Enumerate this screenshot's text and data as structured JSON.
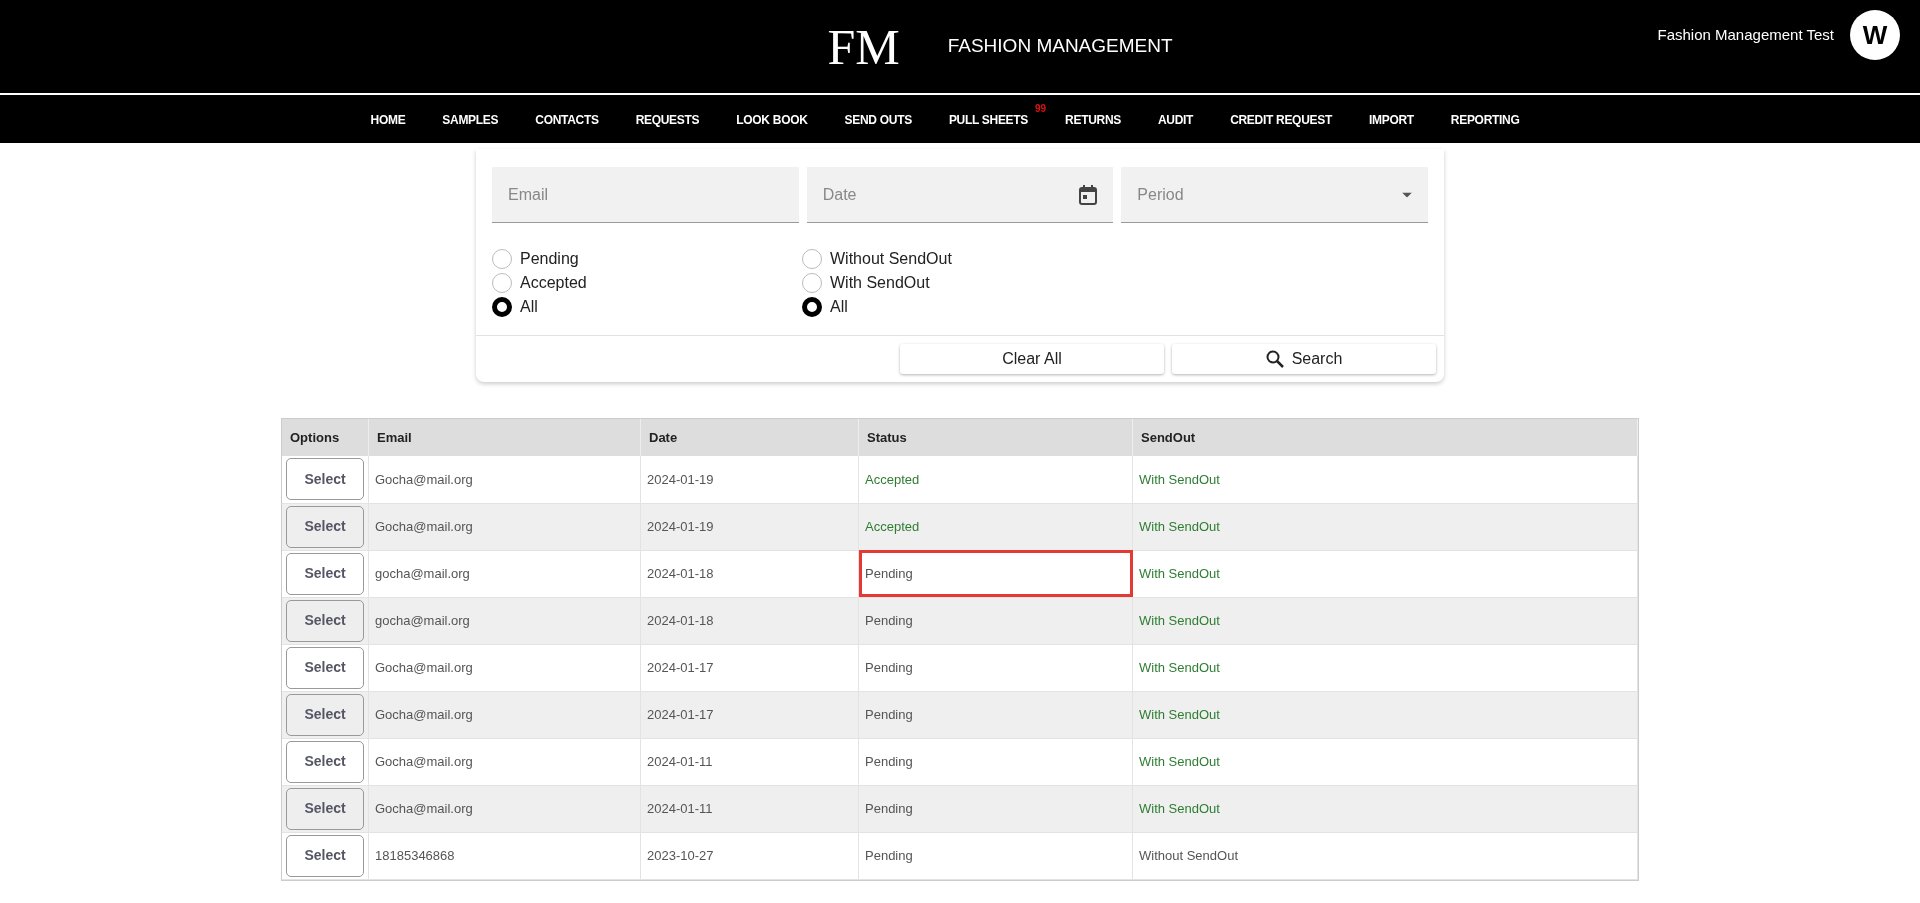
{
  "brand": {
    "logo": "FM",
    "title": "FASHION MANAGEMENT"
  },
  "user": {
    "name": "Fashion Management Test",
    "avatar": "W"
  },
  "nav": [
    {
      "label": "HOME"
    },
    {
      "label": "SAMPLES"
    },
    {
      "label": "CONTACTS"
    },
    {
      "label": "REQUESTS"
    },
    {
      "label": "LOOK BOOK"
    },
    {
      "label": "SEND OUTS"
    },
    {
      "label": "PULL SHEETS",
      "badge": "99"
    },
    {
      "label": "RETURNS"
    },
    {
      "label": "AUDIT"
    },
    {
      "label": "CREDIT REQUEST"
    },
    {
      "label": "IMPORT"
    },
    {
      "label": "REPORTING"
    }
  ],
  "filters": {
    "fields": [
      {
        "kind": "text",
        "placeholder": "Email"
      },
      {
        "kind": "date",
        "placeholder": "Date"
      },
      {
        "kind": "select",
        "placeholder": "Period"
      }
    ],
    "radio_groups": [
      [
        {
          "label": "Pending",
          "selected": false
        },
        {
          "label": "Accepted",
          "selected": false
        },
        {
          "label": "All",
          "selected": true
        }
      ],
      [
        {
          "label": "Without SendOut",
          "selected": false
        },
        {
          "label": "With SendOut",
          "selected": false
        },
        {
          "label": "All",
          "selected": true
        }
      ]
    ],
    "buttons": [
      {
        "label": "Clear All",
        "kind": "plain"
      },
      {
        "label": "Search",
        "kind": "search"
      }
    ]
  },
  "table": {
    "columns": [
      "Options",
      "Email",
      "Date",
      "Status",
      "SendOut"
    ],
    "rows": [
      {
        "option": "Select",
        "email": "Gocha@mail.org",
        "date": "2024-01-19",
        "status": {
          "text": "Accepted",
          "color": "#2e7d32",
          "highlighted": false
        },
        "sendout": {
          "text": "With SendOut",
          "color": "#2e7d32"
        }
      },
      {
        "option": "Select",
        "email": "Gocha@mail.org",
        "date": "2024-01-19",
        "status": {
          "text": "Accepted",
          "color": "#2e7d32",
          "highlighted": false
        },
        "sendout": {
          "text": "With SendOut",
          "color": "#2e7d32"
        }
      },
      {
        "option": "Select",
        "email": "gocha@mail.org",
        "date": "2024-01-18",
        "status": {
          "text": "Pending",
          "color": "#555555",
          "highlighted": true
        },
        "sendout": {
          "text": "With SendOut",
          "color": "#2e7d32"
        }
      },
      {
        "option": "Select",
        "email": "gocha@mail.org",
        "date": "2024-01-18",
        "status": {
          "text": "Pending",
          "color": "#555555",
          "highlighted": false
        },
        "sendout": {
          "text": "With SendOut",
          "color": "#2e7d32"
        }
      },
      {
        "option": "Select",
        "email": "Gocha@mail.org",
        "date": "2024-01-17",
        "status": {
          "text": "Pending",
          "color": "#555555",
          "highlighted": false
        },
        "sendout": {
          "text": "With SendOut",
          "color": "#2e7d32"
        }
      },
      {
        "option": "Select",
        "email": "Gocha@mail.org",
        "date": "2024-01-17",
        "status": {
          "text": "Pending",
          "color": "#555555",
          "highlighted": false
        },
        "sendout": {
          "text": "With SendOut",
          "color": "#2e7d32"
        }
      },
      {
        "option": "Select",
        "email": "Gocha@mail.org",
        "date": "2024-01-11",
        "status": {
          "text": "Pending",
          "color": "#555555",
          "highlighted": false
        },
        "sendout": {
          "text": "With SendOut",
          "color": "#2e7d32"
        }
      },
      {
        "option": "Select",
        "email": "Gocha@mail.org",
        "date": "2024-01-11",
        "status": {
          "text": "Pending",
          "color": "#555555",
          "highlighted": false
        },
        "sendout": {
          "text": "With SendOut",
          "color": "#2e7d32"
        }
      },
      {
        "option": "Select",
        "email": "18185346868",
        "date": "2023-10-27",
        "status": {
          "text": "Pending",
          "color": "#555555",
          "highlighted": false
        },
        "sendout": {
          "text": "Without SendOut",
          "color": "#555555"
        }
      }
    ]
  }
}
